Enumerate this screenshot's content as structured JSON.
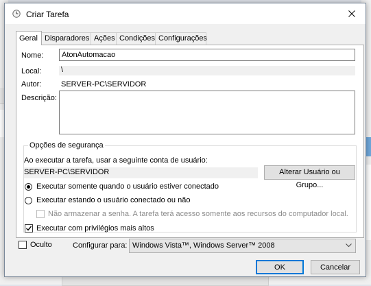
{
  "dialog": {
    "title": "Criar Tarefa"
  },
  "tabs": [
    {
      "label": "Geral",
      "active": true
    },
    {
      "label": "Disparadores"
    },
    {
      "label": "Ações"
    },
    {
      "label": "Condições"
    },
    {
      "label": "Configurações"
    }
  ],
  "general": {
    "name_label": "Nome:",
    "name_value": "AtonAutomacao",
    "location_label": "Local:",
    "location_value": "\\",
    "author_label": "Autor:",
    "author_value": "SERVER-PC\\SERVIDOR",
    "description_label": "Descrição:",
    "description_value": ""
  },
  "security": {
    "group_title": "Opções de segurança",
    "account_prompt": "Ao executar a tarefa, usar a seguinte conta de usuário:",
    "account_value": "SERVER-PC\\SERVIDOR",
    "change_user_button": "Alterar Usuário ou Grupo...",
    "radio_logged_on": "Executar somente quando o usuário estiver conectado",
    "radio_logged_on_checked": true,
    "radio_any": "Executar estando o usuário conectado ou não",
    "radio_any_checked": false,
    "no_store_password": "Não armazenar a senha. A tarefa terá acesso somente aos recursos do computador local.",
    "no_store_password_checked": false,
    "highest_privileges": "Executar com privilégios mais altos",
    "highest_privileges_checked": true
  },
  "footer": {
    "hidden_label": "Oculto",
    "hidden_checked": false,
    "configure_for_label": "Configurar para:",
    "configure_for_value": "Windows Vista™, Windows Server™ 2008",
    "ok_button": "OK",
    "cancel_button": "Cancelar"
  },
  "colors": {
    "accent": "#0078d7",
    "dialog_bg": "#f0f0f0"
  },
  "icons": {
    "title": "clock-icon",
    "close": "close-icon"
  }
}
